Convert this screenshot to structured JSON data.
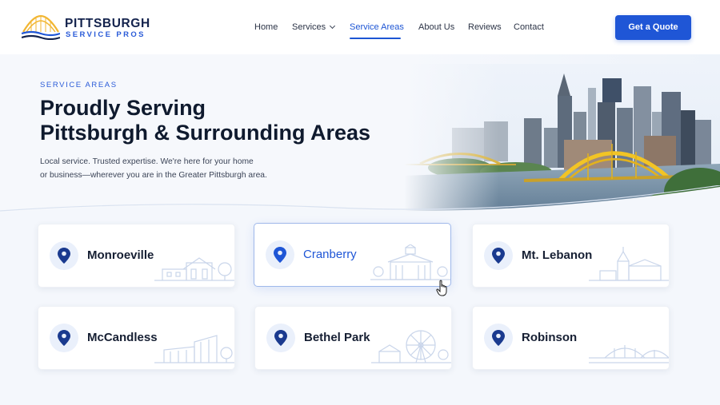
{
  "header": {
    "logo": {
      "title": "PITTSBURGH",
      "subtitle": "SERVICE PROS"
    },
    "nav": [
      {
        "label": "Home",
        "active": false
      },
      {
        "label": "Services",
        "active": false,
        "has_dropdown": true
      },
      {
        "label": "Service Areas",
        "active": true
      },
      {
        "label": "About Us",
        "active": false
      },
      {
        "label": "Reviews",
        "active": false
      },
      {
        "label": "Contact",
        "active": false
      }
    ],
    "cta_label": "Get a Quote"
  },
  "hero": {
    "eyebrow": "SERVICE AREAS",
    "title_line1": "Proudly Serving",
    "title_line2": "Pittsburgh & Surrounding Areas",
    "desc_line1": "Local service.  Trusted expertise.  We're here for your home",
    "desc_line2": "or business—wherever you are in the Greater Pittsburgh area."
  },
  "areas": [
    {
      "label": "Monroeville",
      "icon": "map-pin-icon",
      "illustration": "shopping-building-illustration"
    },
    {
      "label": "Cranberry",
      "icon": "map-pin-icon",
      "illustration": "town-hall-illustration",
      "hovered": true
    },
    {
      "label": "Mt. Lebanon",
      "icon": "map-pin-icon",
      "illustration": "church-illustration"
    },
    {
      "label": "McCandless",
      "icon": "map-pin-icon",
      "illustration": "modern-building-illustration"
    },
    {
      "label": "Bethel Park",
      "icon": "map-pin-icon",
      "illustration": "ferris-wheel-illustration"
    },
    {
      "label": "Robinson",
      "icon": "map-pin-icon",
      "illustration": "bridge-illustration"
    }
  ],
  "colors": {
    "accent": "#1f56d6",
    "heading": "#0f1a2e",
    "pin": "#1a3a8f",
    "pin_bg": "#eaf0fb",
    "illustration": "#c9d5ea"
  }
}
